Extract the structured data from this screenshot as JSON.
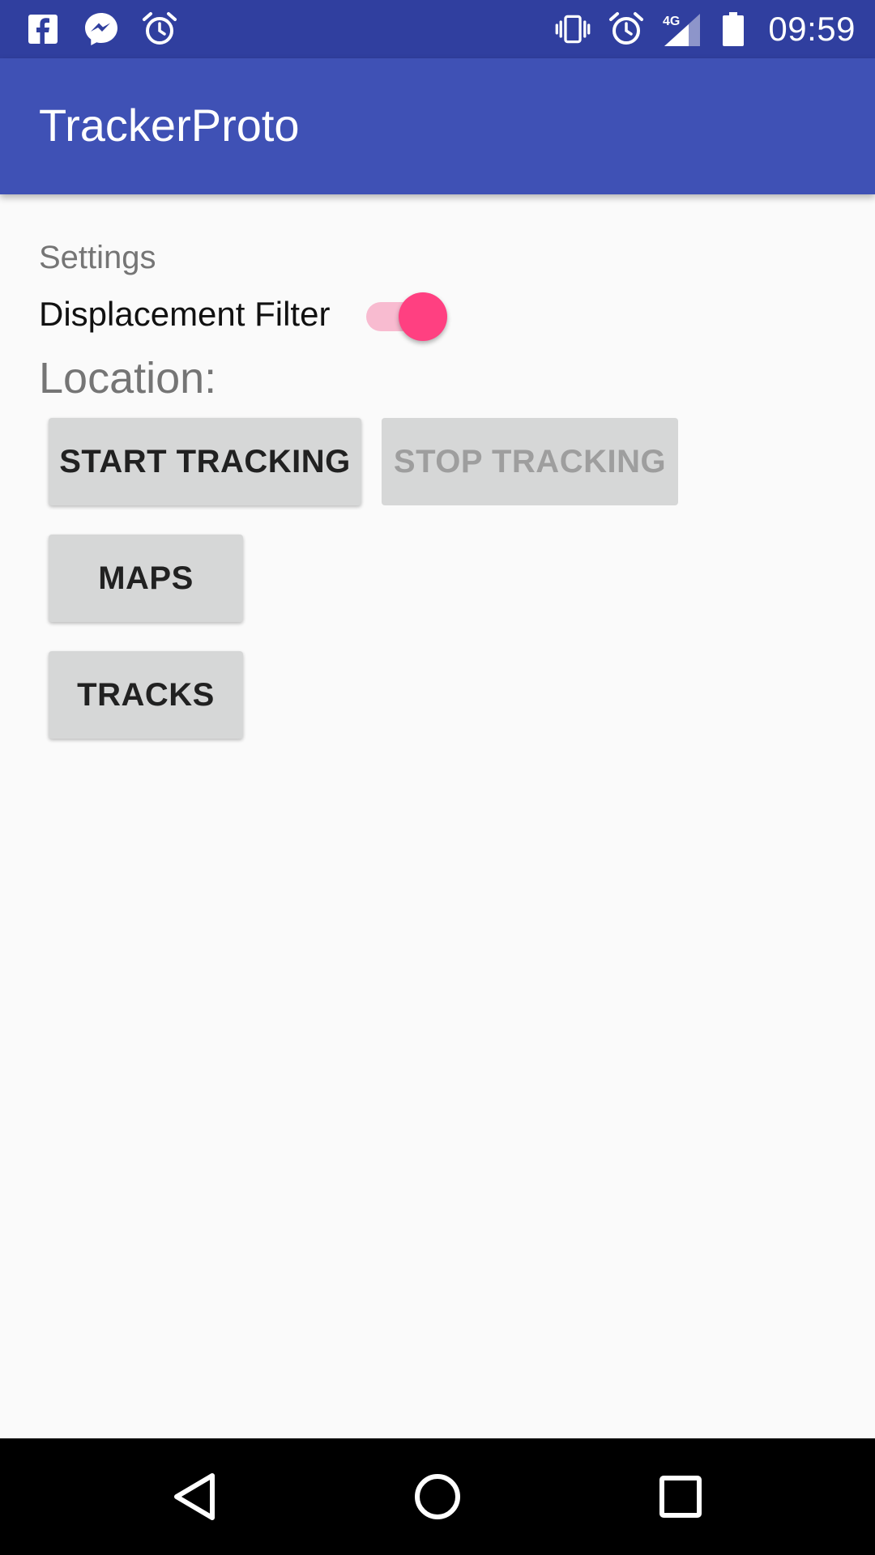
{
  "status_bar": {
    "time": "09:59",
    "network": "4G",
    "left_icons": [
      "facebook-icon",
      "messenger-icon",
      "alarm-icon"
    ],
    "right_icons": [
      "vibrate-icon",
      "alarm-icon",
      "signal-icon",
      "battery-icon"
    ],
    "background_color": "#303f9f"
  },
  "app_bar": {
    "title": "TrackerProto",
    "background_color": "#3f51b5"
  },
  "main": {
    "settings_label": "Settings",
    "displacement_filter": {
      "label": "Displacement Filter",
      "enabled": true,
      "accent_color": "#ff4081"
    },
    "location_label": "Location:",
    "buttons": {
      "start_tracking": "START TRACKING",
      "stop_tracking": "STOP TRACKING",
      "maps": "MAPS",
      "tracks": "TRACKS"
    },
    "stop_tracking_enabled": false
  },
  "nav_bar": {
    "icons": [
      "back-icon",
      "home-icon",
      "recents-icon"
    ]
  }
}
